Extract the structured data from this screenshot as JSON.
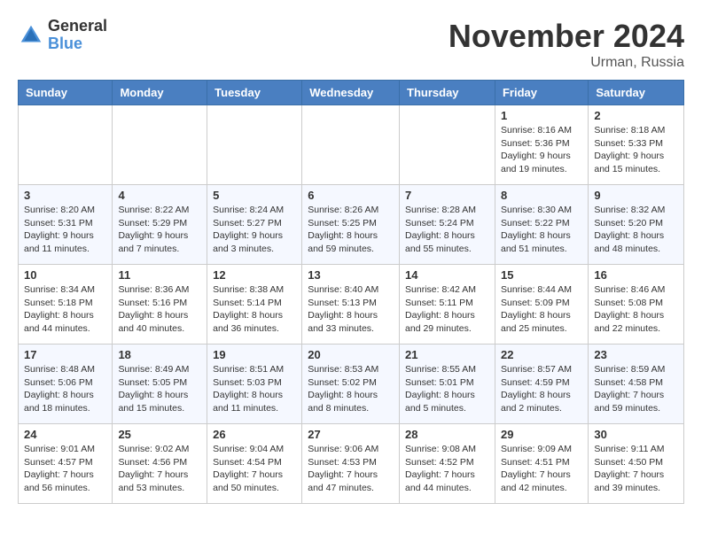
{
  "logo": {
    "general": "General",
    "blue": "Blue"
  },
  "title": "November 2024",
  "location": "Urman, Russia",
  "days_of_week": [
    "Sunday",
    "Monday",
    "Tuesday",
    "Wednesday",
    "Thursday",
    "Friday",
    "Saturday"
  ],
  "weeks": [
    [
      null,
      null,
      null,
      null,
      null,
      {
        "day": "1",
        "sunrise": "Sunrise: 8:16 AM",
        "sunset": "Sunset: 5:36 PM",
        "daylight": "Daylight: 9 hours and 19 minutes."
      },
      {
        "day": "2",
        "sunrise": "Sunrise: 8:18 AM",
        "sunset": "Sunset: 5:33 PM",
        "daylight": "Daylight: 9 hours and 15 minutes."
      }
    ],
    [
      {
        "day": "3",
        "sunrise": "Sunrise: 8:20 AM",
        "sunset": "Sunset: 5:31 PM",
        "daylight": "Daylight: 9 hours and 11 minutes."
      },
      {
        "day": "4",
        "sunrise": "Sunrise: 8:22 AM",
        "sunset": "Sunset: 5:29 PM",
        "daylight": "Daylight: 9 hours and 7 minutes."
      },
      {
        "day": "5",
        "sunrise": "Sunrise: 8:24 AM",
        "sunset": "Sunset: 5:27 PM",
        "daylight": "Daylight: 9 hours and 3 minutes."
      },
      {
        "day": "6",
        "sunrise": "Sunrise: 8:26 AM",
        "sunset": "Sunset: 5:25 PM",
        "daylight": "Daylight: 8 hours and 59 minutes."
      },
      {
        "day": "7",
        "sunrise": "Sunrise: 8:28 AM",
        "sunset": "Sunset: 5:24 PM",
        "daylight": "Daylight: 8 hours and 55 minutes."
      },
      {
        "day": "8",
        "sunrise": "Sunrise: 8:30 AM",
        "sunset": "Sunset: 5:22 PM",
        "daylight": "Daylight: 8 hours and 51 minutes."
      },
      {
        "day": "9",
        "sunrise": "Sunrise: 8:32 AM",
        "sunset": "Sunset: 5:20 PM",
        "daylight": "Daylight: 8 hours and 48 minutes."
      }
    ],
    [
      {
        "day": "10",
        "sunrise": "Sunrise: 8:34 AM",
        "sunset": "Sunset: 5:18 PM",
        "daylight": "Daylight: 8 hours and 44 minutes."
      },
      {
        "day": "11",
        "sunrise": "Sunrise: 8:36 AM",
        "sunset": "Sunset: 5:16 PM",
        "daylight": "Daylight: 8 hours and 40 minutes."
      },
      {
        "day": "12",
        "sunrise": "Sunrise: 8:38 AM",
        "sunset": "Sunset: 5:14 PM",
        "daylight": "Daylight: 8 hours and 36 minutes."
      },
      {
        "day": "13",
        "sunrise": "Sunrise: 8:40 AM",
        "sunset": "Sunset: 5:13 PM",
        "daylight": "Daylight: 8 hours and 33 minutes."
      },
      {
        "day": "14",
        "sunrise": "Sunrise: 8:42 AM",
        "sunset": "Sunset: 5:11 PM",
        "daylight": "Daylight: 8 hours and 29 minutes."
      },
      {
        "day": "15",
        "sunrise": "Sunrise: 8:44 AM",
        "sunset": "Sunset: 5:09 PM",
        "daylight": "Daylight: 8 hours and 25 minutes."
      },
      {
        "day": "16",
        "sunrise": "Sunrise: 8:46 AM",
        "sunset": "Sunset: 5:08 PM",
        "daylight": "Daylight: 8 hours and 22 minutes."
      }
    ],
    [
      {
        "day": "17",
        "sunrise": "Sunrise: 8:48 AM",
        "sunset": "Sunset: 5:06 PM",
        "daylight": "Daylight: 8 hours and 18 minutes."
      },
      {
        "day": "18",
        "sunrise": "Sunrise: 8:49 AM",
        "sunset": "Sunset: 5:05 PM",
        "daylight": "Daylight: 8 hours and 15 minutes."
      },
      {
        "day": "19",
        "sunrise": "Sunrise: 8:51 AM",
        "sunset": "Sunset: 5:03 PM",
        "daylight": "Daylight: 8 hours and 11 minutes."
      },
      {
        "day": "20",
        "sunrise": "Sunrise: 8:53 AM",
        "sunset": "Sunset: 5:02 PM",
        "daylight": "Daylight: 8 hours and 8 minutes."
      },
      {
        "day": "21",
        "sunrise": "Sunrise: 8:55 AM",
        "sunset": "Sunset: 5:01 PM",
        "daylight": "Daylight: 8 hours and 5 minutes."
      },
      {
        "day": "22",
        "sunrise": "Sunrise: 8:57 AM",
        "sunset": "Sunset: 4:59 PM",
        "daylight": "Daylight: 8 hours and 2 minutes."
      },
      {
        "day": "23",
        "sunrise": "Sunrise: 8:59 AM",
        "sunset": "Sunset: 4:58 PM",
        "daylight": "Daylight: 7 hours and 59 minutes."
      }
    ],
    [
      {
        "day": "24",
        "sunrise": "Sunrise: 9:01 AM",
        "sunset": "Sunset: 4:57 PM",
        "daylight": "Daylight: 7 hours and 56 minutes."
      },
      {
        "day": "25",
        "sunrise": "Sunrise: 9:02 AM",
        "sunset": "Sunset: 4:56 PM",
        "daylight": "Daylight: 7 hours and 53 minutes."
      },
      {
        "day": "26",
        "sunrise": "Sunrise: 9:04 AM",
        "sunset": "Sunset: 4:54 PM",
        "daylight": "Daylight: 7 hours and 50 minutes."
      },
      {
        "day": "27",
        "sunrise": "Sunrise: 9:06 AM",
        "sunset": "Sunset: 4:53 PM",
        "daylight": "Daylight: 7 hours and 47 minutes."
      },
      {
        "day": "28",
        "sunrise": "Sunrise: 9:08 AM",
        "sunset": "Sunset: 4:52 PM",
        "daylight": "Daylight: 7 hours and 44 minutes."
      },
      {
        "day": "29",
        "sunrise": "Sunrise: 9:09 AM",
        "sunset": "Sunset: 4:51 PM",
        "daylight": "Daylight: 7 hours and 42 minutes."
      },
      {
        "day": "30",
        "sunrise": "Sunrise: 9:11 AM",
        "sunset": "Sunset: 4:50 PM",
        "daylight": "Daylight: 7 hours and 39 minutes."
      }
    ]
  ]
}
